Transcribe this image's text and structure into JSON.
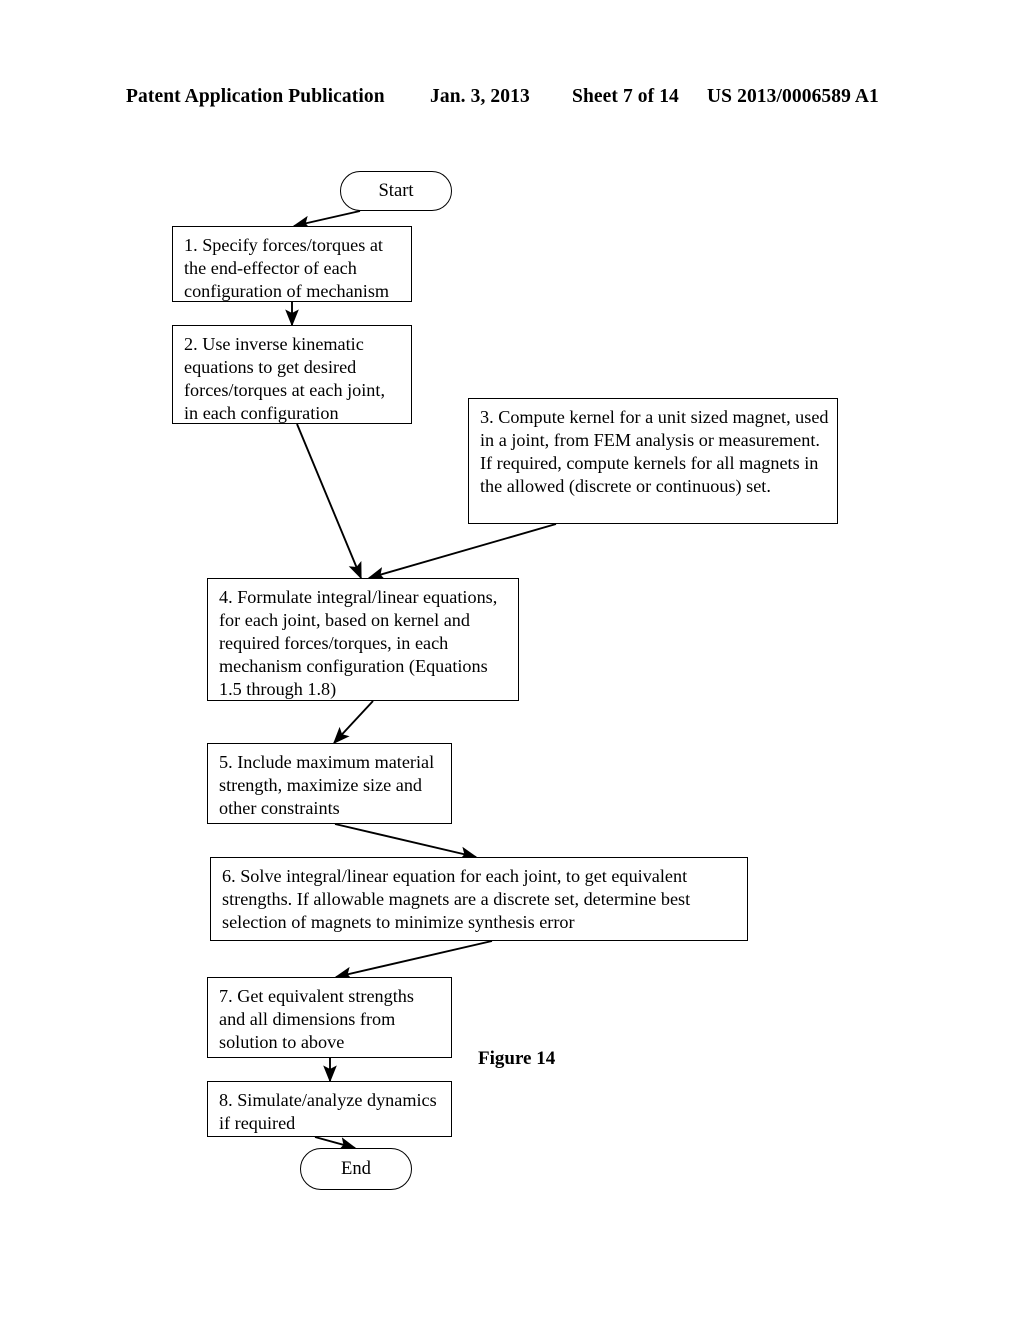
{
  "header": {
    "publication": "Patent Application Publication",
    "date": "Jan. 3, 2013",
    "sheet": "Sheet 7 of 14",
    "document_number": "US 2013/0006589 A1"
  },
  "figure": {
    "caption": "Figure 14"
  },
  "flowchart": {
    "start_label": "Start",
    "end_label": "End",
    "steps": [
      {
        "id": "step1",
        "text": "1. Specify forces/torques at the end-effector of each configuration of mechanism"
      },
      {
        "id": "step2",
        "text": "2. Use inverse kinematic equations to get desired forces/torques at each joint, in each configuration"
      },
      {
        "id": "step3",
        "text": "3. Compute kernel for a unit sized magnet, used in a joint, from FEM analysis or measurement. If required, compute kernels for all magnets in the allowed (discrete or continuous) set."
      },
      {
        "id": "step4",
        "text": "4. Formulate integral/linear equations, for each joint, based on kernel and required forces/torques, in each mechanism configuration (Equations 1.5 through 1.8)"
      },
      {
        "id": "step5",
        "text": "5. Include maximum material strength, maximize size and other constraints"
      },
      {
        "id": "step6",
        "text": "6. Solve integral/linear equation for each joint, to get equivalent strengths. If allowable magnets are a discrete set, determine best selection of magnets to minimize synthesis error"
      },
      {
        "id": "step7",
        "text": "7. Get equivalent strengths and all dimensions from solution to above"
      },
      {
        "id": "step8",
        "text": "8. Simulate/analyze dynamics if required"
      }
    ]
  }
}
